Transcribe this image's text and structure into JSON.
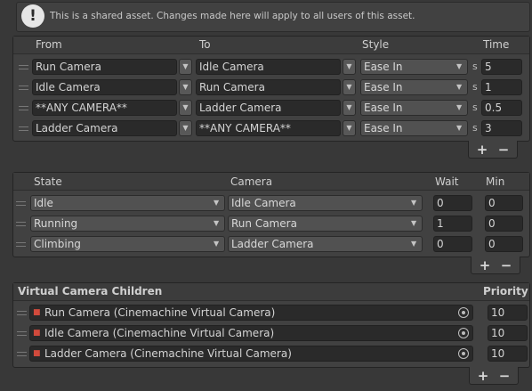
{
  "help_box": {
    "icon": "info-icon",
    "icon_glyph": "!",
    "text": "This is a shared asset.  Changes made here will apply to all users of this asset."
  },
  "blends_table": {
    "headers": {
      "from": "From",
      "to": "To",
      "style": "Style",
      "time": "Time"
    },
    "rows": [
      {
        "from": "Run Camera",
        "to": "Idle Camera",
        "style": "Ease In",
        "unit": "s",
        "time": "5"
      },
      {
        "from": "Idle Camera",
        "to": "Run Camera",
        "style": "Ease In",
        "unit": "s",
        "time": "1"
      },
      {
        "from": "**ANY CAMERA**",
        "to": "Ladder Camera",
        "style": "Ease In",
        "unit": "s",
        "time": "0.5"
      },
      {
        "from": "Ladder Camera",
        "to": "**ANY CAMERA**",
        "style": "Ease In",
        "unit": "s",
        "time": "3"
      }
    ],
    "add_label": "+",
    "remove_label": "−"
  },
  "states_table": {
    "headers": {
      "state": "State",
      "camera": "Camera",
      "wait": "Wait",
      "min": "Min"
    },
    "rows": [
      {
        "state": "Idle",
        "camera": "Idle Camera",
        "wait": "0",
        "min": "0"
      },
      {
        "state": "Running",
        "camera": "Run Camera",
        "wait": "1",
        "min": "0"
      },
      {
        "state": "Climbing",
        "camera": "Ladder Camera",
        "wait": "0",
        "min": "0"
      }
    ],
    "add_label": "+",
    "remove_label": "−"
  },
  "children_table": {
    "headers": {
      "title": "Virtual Camera Children",
      "priority": "Priority"
    },
    "rows": [
      {
        "name": "Run Camera (Cinemachine Virtual Camera)",
        "priority": "10"
      },
      {
        "name": "Idle Camera  (Cinemachine Virtual Camera)",
        "priority": "10"
      },
      {
        "name": "Ladder Camera (Cinemachine Virtual Camera)",
        "priority": "10"
      }
    ],
    "add_label": "+",
    "remove_label": "−"
  },
  "icons": {
    "dropdown": "chevron-down-icon",
    "object_type": "camera-icon",
    "object_picker": "target-icon",
    "drag": "drag-handle-icon"
  }
}
